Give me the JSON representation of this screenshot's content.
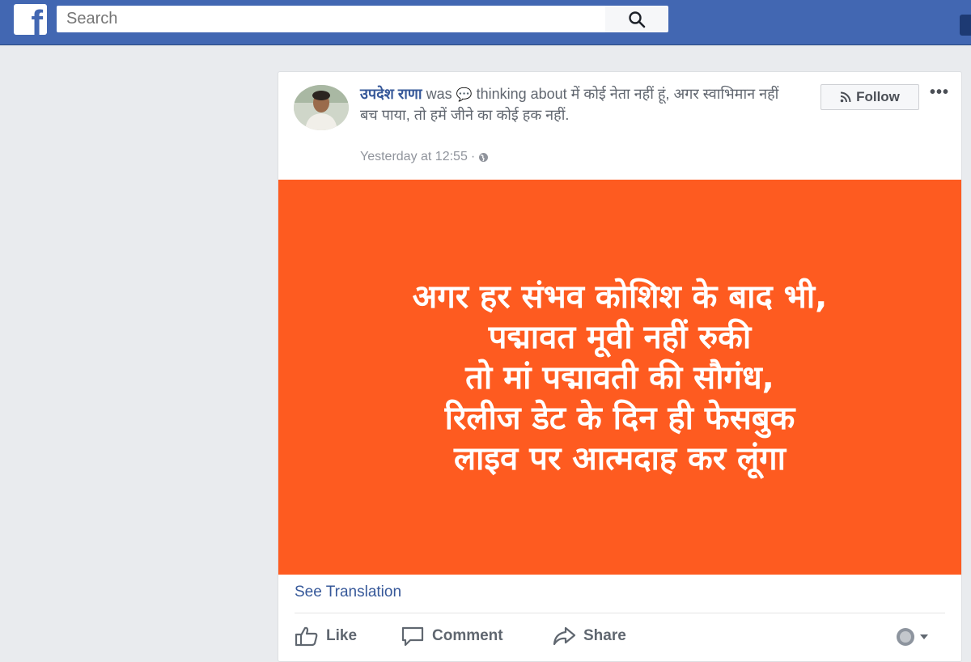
{
  "header": {
    "logo_letter": "f",
    "search_placeholder": "Search",
    "brand_color": "#4267b2"
  },
  "post": {
    "author": "उपदेश राणा",
    "was_text": "was",
    "activity_icon": "speech-bubble-icon",
    "activity": "thinking about में कोई नेता नहीं हूं, अगर स्वाभिमान नहीं बच पाया, तो हमें जीने का कोई हक नहीं.",
    "timestamp": "Yesterday at 12:55",
    "separator": "·",
    "privacy_icon": "globe-icon",
    "follow_label": "Follow",
    "more_label": "•••",
    "image_bg": "#fe5b20",
    "image_lines": [
      "अगर हर संभव कोशिश के बाद भी,",
      "पद्मावत मूवी नहीं रुकी",
      "तो मां पद्मावती की सौगंध,",
      "रिलीज डेट के दिन ही फेसबुक",
      "लाइव पर आत्मदाह कर लूंगा"
    ],
    "see_translation": "See Translation"
  },
  "actions": {
    "like": "Like",
    "comment": "Comment",
    "share": "Share"
  }
}
